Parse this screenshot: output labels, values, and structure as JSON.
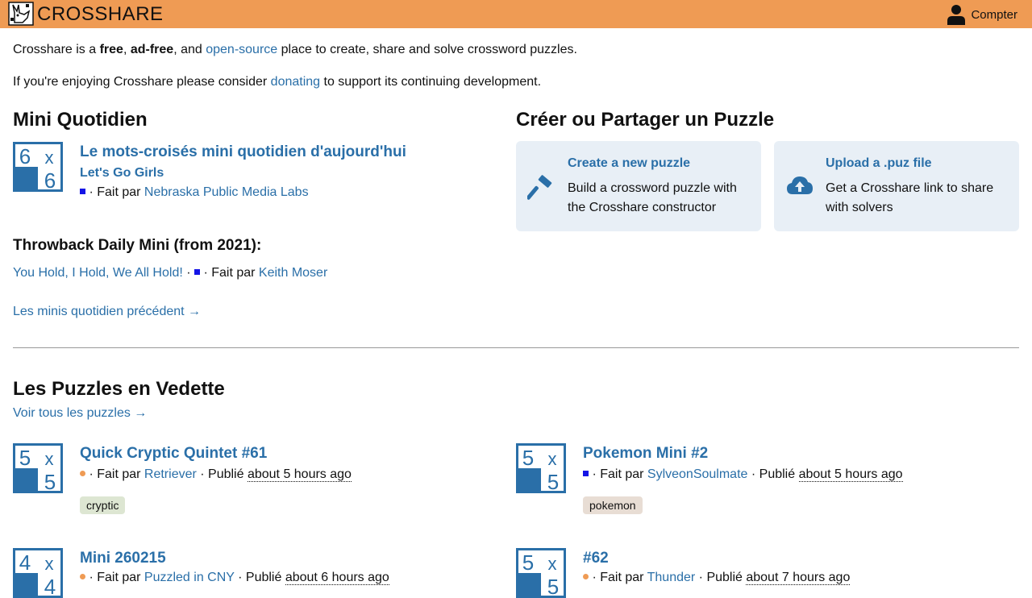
{
  "header": {
    "brand": "CROSSHARE",
    "account_label": "Compter"
  },
  "intro": {
    "line1_a": "Crosshare is a ",
    "line1_free": "free",
    "line1_sep1": ", ",
    "line1_adfree": "ad-free",
    "line1_sep2": ", and ",
    "line1_link": "open-source",
    "line1_b": " place to create, share and solve crossword puzzles.",
    "line2_a": "If you're enjoying Crosshare please consider ",
    "line2_link": "donating",
    "line2_b": " to support its continuing development."
  },
  "mini": {
    "heading": "Mini Quotidien",
    "thumb": {
      "rows": "6",
      "cols": "6"
    },
    "title": "Le mots-croisés mini quotidien d'aujourd'hui",
    "subtitle": "Let's Go Girls",
    "by_sep": " · Fait par ",
    "author": "Nebraska Public Media Labs",
    "throwback_heading": "Throwback Daily Mini (from 2021):",
    "throwback_title": "You Hold, I Hold, We All Hold!",
    "throwback_sep1": " · ",
    "throwback_by": " · Fait par ",
    "throwback_author": "Keith Moser",
    "previous_link": "Les minis quotidien précédent →"
  },
  "create": {
    "heading": "Créer ou Partager un Puzzle",
    "cards": [
      {
        "title": "Create a new puzzle",
        "desc": "Build a crossword puzzle with the Crosshare constructor",
        "icon": "hammer-icon"
      },
      {
        "title": "Upload a .puz file",
        "desc": "Get a Crosshare link to share with solvers",
        "icon": "cloud-upload-icon"
      }
    ]
  },
  "featured": {
    "heading": "Les Puzzles en Vedette",
    "see_all": "Voir tous les puzzles →",
    "by": " · Fait par ",
    "published": " · Publié ",
    "puzzles": [
      {
        "rows": "5",
        "cols": "5",
        "title": "Quick Cryptic Quintet #61",
        "marker": "dot",
        "author": "Retriever",
        "time": "about 5 hours ago",
        "tag": "cryptic"
      },
      {
        "rows": "5",
        "cols": "5",
        "title": "Pokemon Mini #2",
        "marker": "square",
        "author": "SylveonSoulmate",
        "time": "about 5 hours ago",
        "tag": "pokemon"
      },
      {
        "rows": "4",
        "cols": "4",
        "title": "Mini 260215",
        "marker": "dot",
        "author": "Puzzled in CNY",
        "time": "about 6 hours ago"
      },
      {
        "rows": "5",
        "cols": "5",
        "title": "#62",
        "marker": "dot",
        "author": "Thunder",
        "time": "about 7 hours ago"
      }
    ]
  },
  "colors": {
    "header_bg": "#ef9b54",
    "link": "#2a6fa8",
    "card_bg": "#e8eff6",
    "square_marker": "#1414e6",
    "dot_marker": "#ef9b54",
    "tag_cryptic_bg": "#dde6d2",
    "tag_pokemon_bg": "#e8ddd4"
  }
}
